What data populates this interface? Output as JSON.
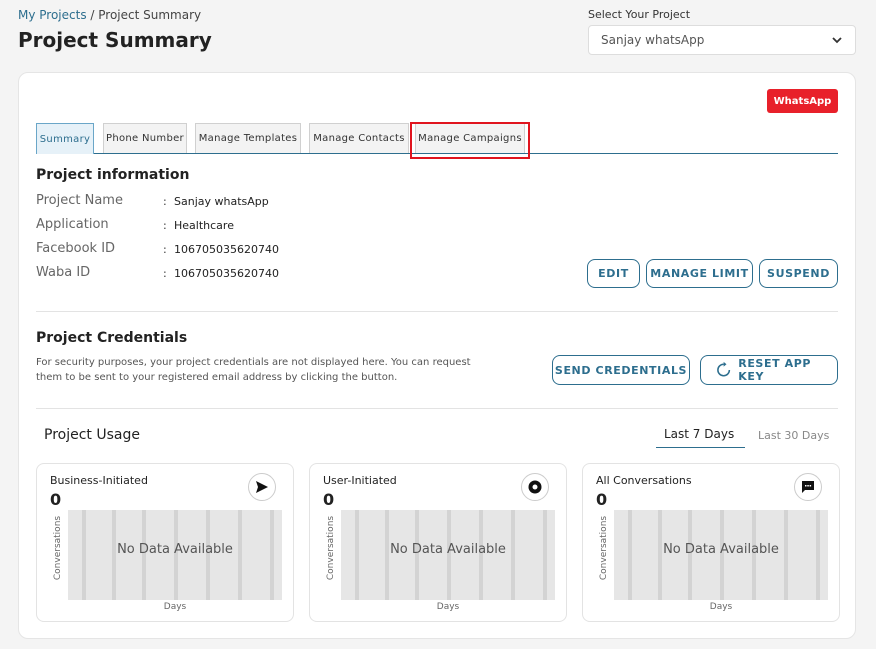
{
  "breadcrumb": {
    "link": "My Projects",
    "separator": " / ",
    "current": "Project Summary"
  },
  "page_title": "Project Summary",
  "project_select": {
    "label": "Select Your Project",
    "value": "Sanjay whatsApp"
  },
  "channel_badge": "WhatsApp",
  "tabs": [
    {
      "label": "Summary"
    },
    {
      "label": "Phone Number"
    },
    {
      "label": "Manage Templates"
    },
    {
      "label": "Manage Contacts"
    },
    {
      "label": "Manage Campaigns"
    }
  ],
  "project_info": {
    "title": "Project information",
    "fields": [
      {
        "label": "Project Name",
        "value": "Sanjay whatsApp"
      },
      {
        "label": "Application",
        "value": "Healthcare"
      },
      {
        "label": "Facebook ID",
        "value": "106705035620740"
      },
      {
        "label": "Waba ID",
        "value": "106705035620740"
      }
    ],
    "colon": ":",
    "buttons": {
      "edit": "EDIT",
      "manage_limit": "MANAGE LIMIT",
      "suspend": "SUSPEND"
    }
  },
  "credentials": {
    "title": "Project Credentials",
    "description": "For security purposes, your project credentials are not displayed here. You can request them to be sent to your registered email address by clicking the button.",
    "send_button": "SEND CREDENTIALS",
    "reset_button": "RESET APP KEY"
  },
  "usage": {
    "title": "Project Usage",
    "ranges": {
      "last7": "Last 7 Days",
      "last30": "Last 30 Days"
    },
    "cards": [
      {
        "label": "Business-Initiated",
        "count": "0",
        "icon": "send-icon",
        "no_data": "No Data Available",
        "ylabel": "Conversations",
        "xlabel": "Days"
      },
      {
        "label": "User-Initiated",
        "count": "0",
        "icon": "user-record-icon",
        "no_data": "No Data Available",
        "ylabel": "Conversations",
        "xlabel": "Days"
      },
      {
        "label": "All Conversations",
        "count": "0",
        "icon": "chat-icon",
        "no_data": "No Data Available",
        "ylabel": "Conversations",
        "xlabel": "Days"
      }
    ]
  },
  "colors": {
    "accent": "#2d6e8e",
    "badge": "#e8202a",
    "highlight": "#e0141e"
  }
}
